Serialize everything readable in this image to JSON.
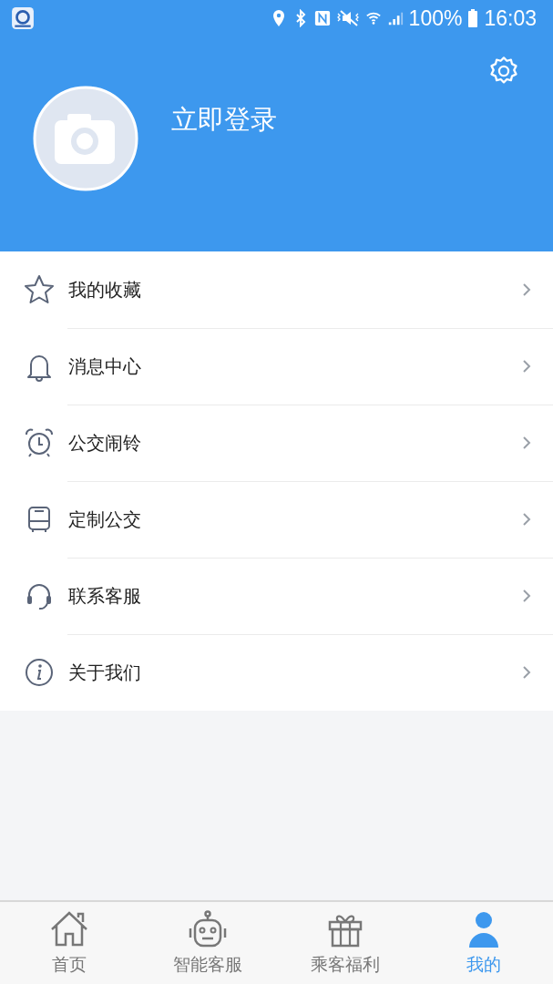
{
  "status_bar": {
    "battery": "100%",
    "time": "16:03"
  },
  "profile": {
    "login_label": "立即登录"
  },
  "menu": [
    {
      "kind": "star",
      "label": "我的收藏"
    },
    {
      "kind": "bell",
      "label": "消息中心"
    },
    {
      "kind": "alarm",
      "label": "公交闹铃"
    },
    {
      "kind": "bus",
      "label": "定制公交"
    },
    {
      "kind": "headset",
      "label": "联系客服"
    },
    {
      "kind": "info",
      "label": "关于我们"
    }
  ],
  "tabs": [
    {
      "kind": "home",
      "label": "首页",
      "selected": false
    },
    {
      "kind": "robot",
      "label": "智能客服",
      "selected": false
    },
    {
      "kind": "gift",
      "label": "乘客福利",
      "selected": false
    },
    {
      "kind": "person",
      "label": "我的",
      "selected": true
    }
  ]
}
